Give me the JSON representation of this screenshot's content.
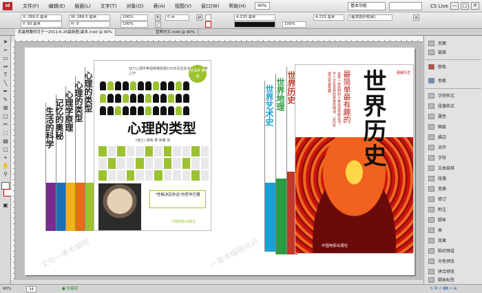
{
  "menubar": {
    "app_logo": "Id",
    "items": [
      "文件(F)",
      "编辑(E)",
      "版面(L)",
      "文字(T)",
      "对象(O)",
      "表(A)",
      "视图(V)",
      "窗口(W)",
      "帮助(H)"
    ],
    "zoom": "90%",
    "workspace": "基本功能",
    "cs_live": "CS Live",
    "window_buttons": [
      "—",
      "□",
      "✕"
    ]
  },
  "control_bar": {
    "x": "X: 289.5 毫米",
    "y": "Y: 93 毫米",
    "w": "W: 289.5 毫米",
    "h": "H: 0",
    "scale1": "100%",
    "scale2": "100%",
    "stroke": "0 点",
    "opacity": "100%",
    "stroke_weight": "4.233 毫米",
    "mm_value": "4.233 毫米",
    "frame_style": "[基本图形框架]",
    "percent": "100%"
  },
  "tabs": [
    {
      "label": "贰最想要的月于一2011-6-26最新图-副本.indd @ 90%",
      "active": true
    },
    {
      "label": "营养内文.indd @ 90%",
      "active": false
    }
  ],
  "book1": {
    "spines": [
      "生活的科学",
      "记忆的奥秘",
      "心理学原理",
      "心理的类型",
      "心理的类型"
    ],
    "title": "心理的类型",
    "tagline": "动力心理学鼻祖荣格经典150年间宝贵全部一部精神之作",
    "badge": "全译本 精装",
    "subtitle": "(瑞士) 荣格 著  吴康 译",
    "quote": "\"性格决定命运\"的哲学巨著",
    "publisher": "中国电影出版社"
  },
  "book2": {
    "spines": [
      "世界艺术史",
      "世界地理",
      "世界历史"
    ],
    "title": "世界历史",
    "subtitle": "最简单最有趣的",
    "blurb": "这是一本简明的人类史迷你版全书，今人文化背景的思维的阐述，让历史成为有益有趣",
    "badge": "图解历史",
    "publisher": "中国电影出版社"
  },
  "watermark": [
    "文化一美术编辑",
    "一美术编辑培训"
  ],
  "panel": {
    "items": [
      "页面",
      "链接",
      "颜色",
      "色板",
      "字符样式",
      "段落样式",
      "属性",
      "图层",
      "描边",
      "对齐",
      "字符",
      "文本绕排",
      "段落",
      "变换",
      "修订",
      "附注",
      "脚本",
      "表",
      "效果",
      "陷印预设",
      "分色预览",
      "拼合预览",
      "脚本标签"
    ]
  },
  "status": {
    "page": "34",
    "zoom": "90%",
    "errors": "● 无错误",
    "taskbar": "S 中 ♪ ⌨ ✂ ⊞"
  }
}
